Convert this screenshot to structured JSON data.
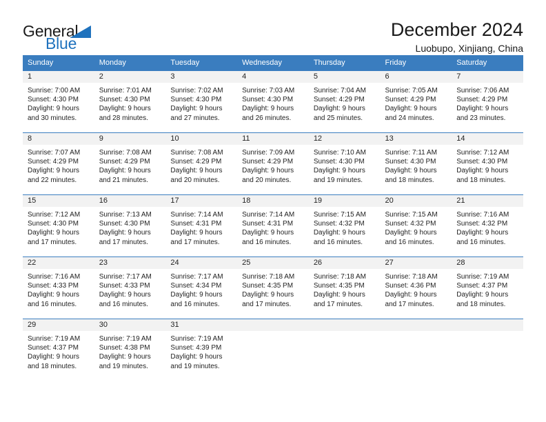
{
  "logo": {
    "primary_text": "General",
    "secondary_text": "Blue",
    "triangle_color": "#1f72bd",
    "accent_color": "#1f72bd"
  },
  "header": {
    "title": "December 2024",
    "subtitle": "Luobupo, Xinjiang, China"
  },
  "theme": {
    "header_bg": "#3a7dbf",
    "daynum_bg": "#f2f2f2",
    "text": "#222222",
    "page_bg": "#ffffff"
  },
  "weekday_headers": [
    "Sunday",
    "Monday",
    "Tuesday",
    "Wednesday",
    "Thursday",
    "Friday",
    "Saturday"
  ],
  "weeks": [
    [
      {
        "day": "1",
        "sunrise": "Sunrise: 7:00 AM",
        "sunset": "Sunset: 4:30 PM",
        "daylight_line1": "Daylight: 9 hours",
        "daylight_line2": "and 30 minutes."
      },
      {
        "day": "2",
        "sunrise": "Sunrise: 7:01 AM",
        "sunset": "Sunset: 4:30 PM",
        "daylight_line1": "Daylight: 9 hours",
        "daylight_line2": "and 28 minutes."
      },
      {
        "day": "3",
        "sunrise": "Sunrise: 7:02 AM",
        "sunset": "Sunset: 4:30 PM",
        "daylight_line1": "Daylight: 9 hours",
        "daylight_line2": "and 27 minutes."
      },
      {
        "day": "4",
        "sunrise": "Sunrise: 7:03 AM",
        "sunset": "Sunset: 4:30 PM",
        "daylight_line1": "Daylight: 9 hours",
        "daylight_line2": "and 26 minutes."
      },
      {
        "day": "5",
        "sunrise": "Sunrise: 7:04 AM",
        "sunset": "Sunset: 4:29 PM",
        "daylight_line1": "Daylight: 9 hours",
        "daylight_line2": "and 25 minutes."
      },
      {
        "day": "6",
        "sunrise": "Sunrise: 7:05 AM",
        "sunset": "Sunset: 4:29 PM",
        "daylight_line1": "Daylight: 9 hours",
        "daylight_line2": "and 24 minutes."
      },
      {
        "day": "7",
        "sunrise": "Sunrise: 7:06 AM",
        "sunset": "Sunset: 4:29 PM",
        "daylight_line1": "Daylight: 9 hours",
        "daylight_line2": "and 23 minutes."
      }
    ],
    [
      {
        "day": "8",
        "sunrise": "Sunrise: 7:07 AM",
        "sunset": "Sunset: 4:29 PM",
        "daylight_line1": "Daylight: 9 hours",
        "daylight_line2": "and 22 minutes."
      },
      {
        "day": "9",
        "sunrise": "Sunrise: 7:08 AM",
        "sunset": "Sunset: 4:29 PM",
        "daylight_line1": "Daylight: 9 hours",
        "daylight_line2": "and 21 minutes."
      },
      {
        "day": "10",
        "sunrise": "Sunrise: 7:08 AM",
        "sunset": "Sunset: 4:29 PM",
        "daylight_line1": "Daylight: 9 hours",
        "daylight_line2": "and 20 minutes."
      },
      {
        "day": "11",
        "sunrise": "Sunrise: 7:09 AM",
        "sunset": "Sunset: 4:29 PM",
        "daylight_line1": "Daylight: 9 hours",
        "daylight_line2": "and 20 minutes."
      },
      {
        "day": "12",
        "sunrise": "Sunrise: 7:10 AM",
        "sunset": "Sunset: 4:30 PM",
        "daylight_line1": "Daylight: 9 hours",
        "daylight_line2": "and 19 minutes."
      },
      {
        "day": "13",
        "sunrise": "Sunrise: 7:11 AM",
        "sunset": "Sunset: 4:30 PM",
        "daylight_line1": "Daylight: 9 hours",
        "daylight_line2": "and 18 minutes."
      },
      {
        "day": "14",
        "sunrise": "Sunrise: 7:12 AM",
        "sunset": "Sunset: 4:30 PM",
        "daylight_line1": "Daylight: 9 hours",
        "daylight_line2": "and 18 minutes."
      }
    ],
    [
      {
        "day": "15",
        "sunrise": "Sunrise: 7:12 AM",
        "sunset": "Sunset: 4:30 PM",
        "daylight_line1": "Daylight: 9 hours",
        "daylight_line2": "and 17 minutes."
      },
      {
        "day": "16",
        "sunrise": "Sunrise: 7:13 AM",
        "sunset": "Sunset: 4:30 PM",
        "daylight_line1": "Daylight: 9 hours",
        "daylight_line2": "and 17 minutes."
      },
      {
        "day": "17",
        "sunrise": "Sunrise: 7:14 AM",
        "sunset": "Sunset: 4:31 PM",
        "daylight_line1": "Daylight: 9 hours",
        "daylight_line2": "and 17 minutes."
      },
      {
        "day": "18",
        "sunrise": "Sunrise: 7:14 AM",
        "sunset": "Sunset: 4:31 PM",
        "daylight_line1": "Daylight: 9 hours",
        "daylight_line2": "and 16 minutes."
      },
      {
        "day": "19",
        "sunrise": "Sunrise: 7:15 AM",
        "sunset": "Sunset: 4:32 PM",
        "daylight_line1": "Daylight: 9 hours",
        "daylight_line2": "and 16 minutes."
      },
      {
        "day": "20",
        "sunrise": "Sunrise: 7:15 AM",
        "sunset": "Sunset: 4:32 PM",
        "daylight_line1": "Daylight: 9 hours",
        "daylight_line2": "and 16 minutes."
      },
      {
        "day": "21",
        "sunrise": "Sunrise: 7:16 AM",
        "sunset": "Sunset: 4:32 PM",
        "daylight_line1": "Daylight: 9 hours",
        "daylight_line2": "and 16 minutes."
      }
    ],
    [
      {
        "day": "22",
        "sunrise": "Sunrise: 7:16 AM",
        "sunset": "Sunset: 4:33 PM",
        "daylight_line1": "Daylight: 9 hours",
        "daylight_line2": "and 16 minutes."
      },
      {
        "day": "23",
        "sunrise": "Sunrise: 7:17 AM",
        "sunset": "Sunset: 4:33 PM",
        "daylight_line1": "Daylight: 9 hours",
        "daylight_line2": "and 16 minutes."
      },
      {
        "day": "24",
        "sunrise": "Sunrise: 7:17 AM",
        "sunset": "Sunset: 4:34 PM",
        "daylight_line1": "Daylight: 9 hours",
        "daylight_line2": "and 16 minutes."
      },
      {
        "day": "25",
        "sunrise": "Sunrise: 7:18 AM",
        "sunset": "Sunset: 4:35 PM",
        "daylight_line1": "Daylight: 9 hours",
        "daylight_line2": "and 17 minutes."
      },
      {
        "day": "26",
        "sunrise": "Sunrise: 7:18 AM",
        "sunset": "Sunset: 4:35 PM",
        "daylight_line1": "Daylight: 9 hours",
        "daylight_line2": "and 17 minutes."
      },
      {
        "day": "27",
        "sunrise": "Sunrise: 7:18 AM",
        "sunset": "Sunset: 4:36 PM",
        "daylight_line1": "Daylight: 9 hours",
        "daylight_line2": "and 17 minutes."
      },
      {
        "day": "28",
        "sunrise": "Sunrise: 7:19 AM",
        "sunset": "Sunset: 4:37 PM",
        "daylight_line1": "Daylight: 9 hours",
        "daylight_line2": "and 18 minutes."
      }
    ],
    [
      {
        "day": "29",
        "sunrise": "Sunrise: 7:19 AM",
        "sunset": "Sunset: 4:37 PM",
        "daylight_line1": "Daylight: 9 hours",
        "daylight_line2": "and 18 minutes."
      },
      {
        "day": "30",
        "sunrise": "Sunrise: 7:19 AM",
        "sunset": "Sunset: 4:38 PM",
        "daylight_line1": "Daylight: 9 hours",
        "daylight_line2": "and 19 minutes."
      },
      {
        "day": "31",
        "sunrise": "Sunrise: 7:19 AM",
        "sunset": "Sunset: 4:39 PM",
        "daylight_line1": "Daylight: 9 hours",
        "daylight_line2": "and 19 minutes."
      },
      {
        "day": "",
        "sunrise": "",
        "sunset": "",
        "daylight_line1": "",
        "daylight_line2": ""
      },
      {
        "day": "",
        "sunrise": "",
        "sunset": "",
        "daylight_line1": "",
        "daylight_line2": ""
      },
      {
        "day": "",
        "sunrise": "",
        "sunset": "",
        "daylight_line1": "",
        "daylight_line2": ""
      },
      {
        "day": "",
        "sunrise": "",
        "sunset": "",
        "daylight_line1": "",
        "daylight_line2": ""
      }
    ]
  ]
}
